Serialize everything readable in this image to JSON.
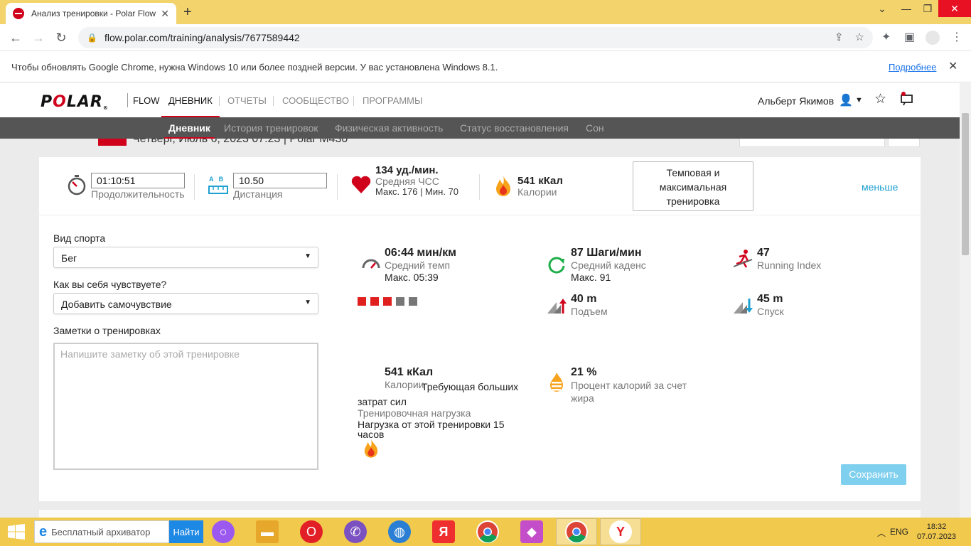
{
  "browser": {
    "tab_title": "Анализ тренировки - Polar Flow",
    "url": "flow.polar.com/training/analysis/7677589442",
    "infobar_message": "Чтобы обновлять Google Chrome, нужна Windows 10 или более поздней версии. У вас установлена Windows 8.1.",
    "infobar_link": "Подробнее"
  },
  "site": {
    "flow_label": "FLOW",
    "nav": [
      "ДНЕВНИК",
      "ОТЧЕТЫ",
      "СООБЩЕСТВО",
      "ПРОГРАММЫ"
    ],
    "user_name": "Альберт Якимов",
    "subnav": [
      "Дневник",
      "История тренировок",
      "Физическая активность",
      "Статус восстановления",
      "Сон"
    ],
    "header_peek": "Четверг, Июль 6, 2023 07:23 | Polar M430"
  },
  "summary": {
    "duration_value": "01:10:51",
    "duration_label": "Продолжительность",
    "distance_ab": "A   B",
    "distance_value": "10.50",
    "distance_label": "Дистанция",
    "hr_value": "134 уд./мин.",
    "hr_label": "Средняя ЧСС",
    "hr_sub": "Макс. 176  |  Мин. 70",
    "calories_value": "541 кКал",
    "calories_label": "Калории",
    "benefit": "Темповая и максимальная тренировка",
    "less_link": "меньше"
  },
  "form": {
    "sport_label": "Вид спорта",
    "sport_value": "Бег",
    "feeling_label": "Как вы себя чувствуете?",
    "feeling_value": "Добавить самочувствие",
    "notes_label": "Заметки о тренировках",
    "notes_placeholder": "Напишите заметку об этой тренировке"
  },
  "metrics": {
    "pace_value": "06:44 мин/км",
    "pace_label": "Средний темп",
    "pace_sub": "Макс. 05:39",
    "cadence_value": "87 Шаги/мин",
    "cadence_label": "Средний каденс",
    "cadence_sub": "Макс. 91",
    "running_index_value": "47",
    "running_index_label": "Running Index",
    "load_text": "Требующая больших затрат сил",
    "load_label": "Тренировочная нагрузка",
    "load_sub": "Нагрузка от этой тренировки 15 часов",
    "load_filled": 3,
    "load_total": 5,
    "ascent_value": "40 m",
    "ascent_label": "Подъем",
    "descent_value": "45 m",
    "descent_label": "Спуск",
    "calories_value": "541 кКал",
    "calories_label": "Калории",
    "fat_value": "21 %",
    "fat_label": "Процент калорий за счет жира"
  },
  "save_label": "Сохранить",
  "taskbar": {
    "search_text": "Бесплатный архиватор",
    "find_label": "Найти",
    "lang": "ENG",
    "time": "18:32",
    "date": "07.07.2023"
  },
  "colors": {
    "polar_red": "#d0021b",
    "accent_blue": "#1ea0d0",
    "load_filled": "#e0201e",
    "load_empty": "#777777",
    "subnav_bg": "#555555",
    "taskbar_bg": "#f1c94d"
  },
  "icons": [
    "stopwatch-icon",
    "distance-ruler-icon",
    "heart-icon",
    "flame-icon",
    "speedometer-icon",
    "cadence-icon",
    "running-index-icon",
    "ascent-icon",
    "descent-icon",
    "fat-burn-icon"
  ]
}
